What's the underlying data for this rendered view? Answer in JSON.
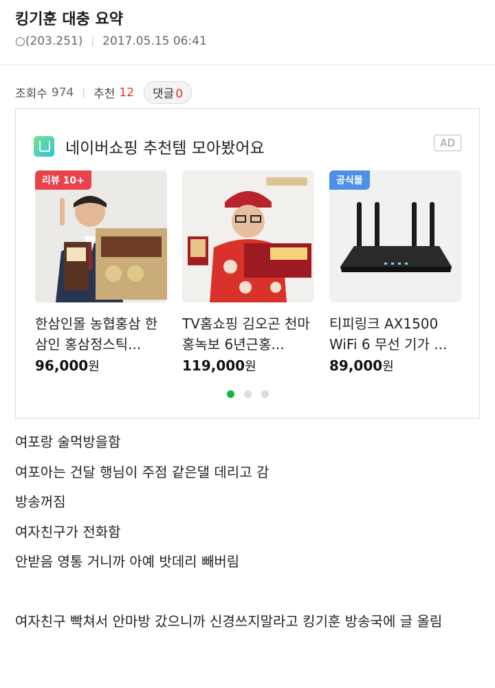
{
  "post": {
    "title": "킹기훈 대충 요약",
    "author": "○(203.251)",
    "date": "2017.05.15 06:41"
  },
  "stats": {
    "views_label": "조회수",
    "views": "974",
    "recommend_label": "추천",
    "recommend": "12",
    "comments_label": "댓글",
    "comments": "0"
  },
  "ad": {
    "title": "네이버쇼핑 추천템 모아봤어요",
    "badge": "AD",
    "products": [
      {
        "tag": "리뷰 10+",
        "name": "한삼인몰 농협홍삼 한삼인 홍삼정스틱...",
        "price": "96,000",
        "won": "원"
      },
      {
        "tag": "",
        "name": "TV홈쇼핑 김오곤 천마홍녹보 6년근홍...",
        "price": "119,000",
        "won": "원"
      },
      {
        "tag": "공식몰",
        "name": "티피링크 AX1500 WiFi 6 무선 기가 ...",
        "price": "89,000",
        "won": "원"
      }
    ],
    "pager": {
      "pages": 3,
      "current": 1
    }
  },
  "body": {
    "lines": [
      "여포랑 술먹방을함",
      "여포아는 건달 행님이 주점 같은댈 데리고 감",
      "방송꺼짐",
      "여자친구가 전화함",
      "안받음 영통 거니까 아예 밧데리 빼버림",
      "",
      "여자친구 빡쳐서 안마방 갔으니까 신경쓰지말라고 킹기훈 방송국에 글 올림"
    ]
  }
}
